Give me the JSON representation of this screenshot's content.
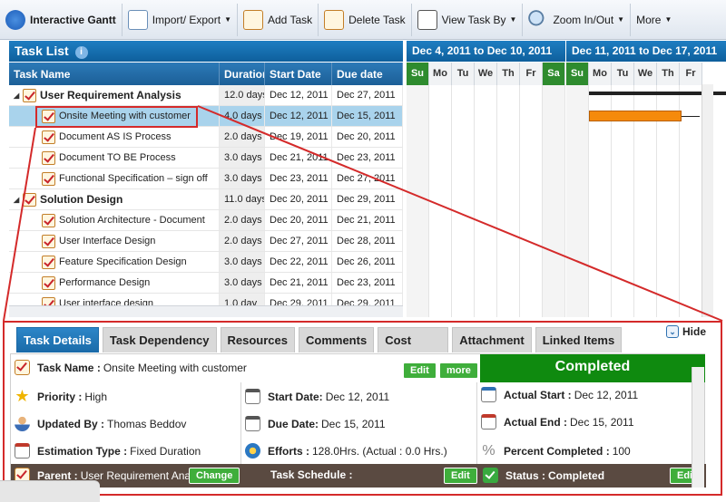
{
  "toolbar": {
    "app_title": "Interactive Gantt",
    "import_export": "Import/ Export",
    "add_task": "Add Task",
    "delete_task": "Delete Task",
    "view_task_by": "View Task By",
    "zoom": "Zoom In/Out",
    "more": "More"
  },
  "task_list": {
    "title": "Task List",
    "columns": [
      "Task Name",
      "Duration",
      "Start Date",
      "Due date"
    ],
    "rows": [
      {
        "name": "User Requirement Analysis",
        "duration": "12.0 days",
        "start": "Dec 12, 2011",
        "due": "Dec 27, 2011",
        "group": true
      },
      {
        "name": "Onsite Meeting with customer",
        "duration": "4.0 days",
        "start": "Dec 12, 2011",
        "due": "Dec 15, 2011",
        "selected": true
      },
      {
        "name": "Document AS IS Process",
        "duration": "2.0 days",
        "start": "Dec 19, 2011",
        "due": "Dec 20, 2011"
      },
      {
        "name": "Document TO BE Process",
        "duration": "3.0 days",
        "start": "Dec 21, 2011",
        "due": "Dec 23, 2011"
      },
      {
        "name": "Functional Specification – sign off",
        "duration": "3.0 days",
        "start": "Dec 23, 2011",
        "due": "Dec 27, 2011"
      },
      {
        "name": "Solution Design",
        "duration": "11.0 days",
        "start": "Dec 20, 2011",
        "due": "Dec 29, 2011",
        "group": true
      },
      {
        "name": "Solution Architecture - Document",
        "duration": "2.0 days",
        "start": "Dec 20, 2011",
        "due": "Dec 21, 2011"
      },
      {
        "name": "User Interface Design",
        "duration": "2.0 days",
        "start": "Dec 27, 2011",
        "due": "Dec 28, 2011"
      },
      {
        "name": "Feature Specification Design",
        "duration": "3.0 days",
        "start": "Dec 22, 2011",
        "due": "Dec 26, 2011"
      },
      {
        "name": "Performance Design",
        "duration": "3.0 days",
        "start": "Dec 21, 2011",
        "due": "Dec 23, 2011"
      },
      {
        "name": "User interface design",
        "duration": "1.0 day",
        "start": "Dec 29, 2011",
        "due": "Dec 29, 2011"
      }
    ]
  },
  "gantt": {
    "week1": "Dec 4, 2011 to Dec 10, 2011",
    "week2": "Dec 11, 2011 to Dec 17, 2011",
    "days": [
      "Su",
      "Mo",
      "Tu",
      "We",
      "Th",
      "Fr",
      "Sa",
      "Su",
      "Mo",
      "Tu",
      "We",
      "Th",
      "Fr"
    ]
  },
  "detail": {
    "tabs": [
      "Task Details",
      "Task Dependency",
      "Resources",
      "Comments",
      "Cost",
      "Attachment",
      "Linked Items"
    ],
    "hide": "Hide",
    "status_banner": "Completed",
    "edit": "Edit",
    "more": "more",
    "change": "Change",
    "task_name_label": "Task Name :",
    "task_name": "Onsite Meeting with customer",
    "priority_label": "Priority :",
    "priority": "High",
    "updated_by_label": "Updated By :",
    "updated_by": "Thomas Beddov",
    "estimation_label": "Estimation Type :",
    "estimation": "Fixed Duration",
    "parent_label": "Parent :",
    "parent": "User Requirement Analysis",
    "start_label": "Start Date:",
    "start": "Dec 12, 2011",
    "due_label": "Due Date:",
    "due": "Dec 15, 2011",
    "efforts_label": "Efforts :",
    "efforts": "128.0Hrs. (Actual : 0.0 Hrs.)",
    "schedule_label": "Task Schedule :",
    "actual_start_label": "Actual Start :",
    "actual_start": "Dec 12, 2011",
    "actual_end_label": "Actual End :",
    "actual_end": "Dec 15, 2011",
    "percent_label": "Percent Completed :",
    "percent": "100",
    "status_label": "Status :",
    "status": "Completed"
  },
  "colors": {
    "accent": "#1a6aa8",
    "weekend": "#2e8b2e",
    "bar": "#f58a0b",
    "highlight": "#d42a2a",
    "completed": "#0f8a0f"
  }
}
